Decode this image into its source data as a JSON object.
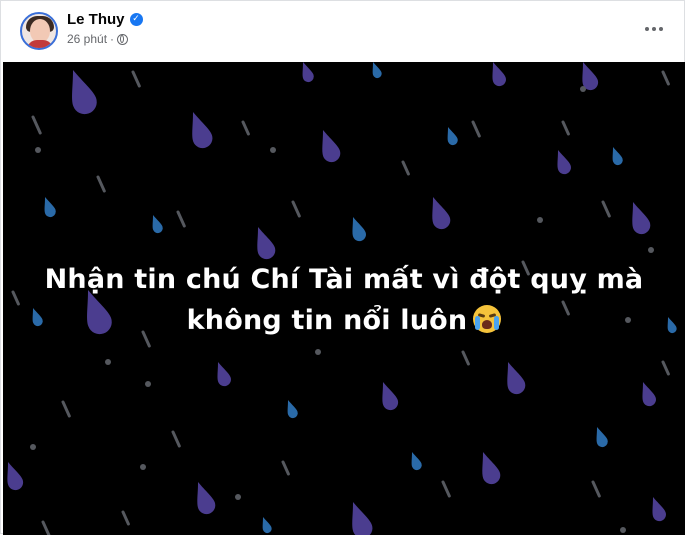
{
  "post": {
    "author": "Le Thuy",
    "time": "26 phút",
    "separator": "·",
    "verified_icon": "✓",
    "privacy_icon": "globe-icon",
    "more_icon": "more-options-icon",
    "message_line1": "Nhận tin chú Chí Tài mất vì đột quỵ mà",
    "message_line2": "không tin nổi luôn",
    "emoji": "loudly-crying-face"
  },
  "colors": {
    "background": "#000000",
    "text": "#ffffff",
    "drop_purple": "#4b3d8f",
    "drop_blue": "#2a6aa8",
    "streak": "#55585e",
    "verified": "#1877f2"
  }
}
